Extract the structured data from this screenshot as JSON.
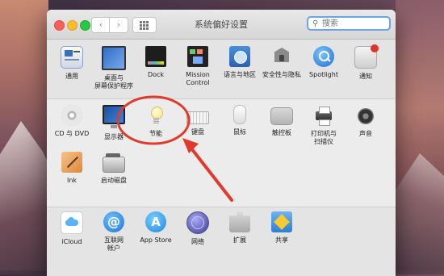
{
  "window": {
    "title": "系统偏好设置"
  },
  "toolbar": {
    "back": "‹",
    "forward": "›"
  },
  "search": {
    "placeholder": "搜索",
    "icon": "magnifier-icon"
  },
  "row1": [
    {
      "label": "通用",
      "icon": "general-icon"
    },
    {
      "label": "桌面与\n屏幕保护程序",
      "icon": "desktop-screensaver-icon"
    },
    {
      "label": "Dock",
      "icon": "dock-icon"
    },
    {
      "label": "Mission\nControl",
      "icon": "mission-control-icon"
    },
    {
      "label": "语言与地区",
      "icon": "language-region-icon"
    },
    {
      "label": "安全性与隐私",
      "icon": "security-privacy-icon"
    },
    {
      "label": "Spotlight",
      "icon": "spotlight-icon"
    },
    {
      "label": "通知",
      "icon": "notifications-icon"
    }
  ],
  "row2": [
    {
      "label": "CD 与 DVD",
      "icon": "cd-dvd-icon"
    },
    {
      "label": "显示器",
      "icon": "displays-icon"
    },
    {
      "label": "节能",
      "icon": "energy-saver-icon"
    },
    {
      "label": "键盘",
      "icon": "keyboard-icon"
    },
    {
      "label": "鼠标",
      "icon": "mouse-icon"
    },
    {
      "label": "触控板",
      "icon": "trackpad-icon"
    },
    {
      "label": "打印机与\n扫描仪",
      "icon": "printers-scanners-icon"
    },
    {
      "label": "声音",
      "icon": "sound-icon"
    }
  ],
  "row3": [
    {
      "label": "Ink",
      "icon": "ink-icon"
    },
    {
      "label": "启动磁盘",
      "icon": "startup-disk-icon"
    }
  ],
  "row4": [
    {
      "label": "iCloud",
      "icon": "icloud-icon"
    },
    {
      "label": "互联网\n帐户",
      "icon": "internet-accounts-icon"
    },
    {
      "label": "App Store",
      "icon": "app-store-icon"
    },
    {
      "label": "网络",
      "icon": "network-icon"
    },
    {
      "label": "扩展",
      "icon": "extensions-icon"
    },
    {
      "label": "共享",
      "icon": "sharing-icon"
    }
  ],
  "colors": {
    "annotation": "#e03a2e",
    "search_focus": "#6ca2e6"
  }
}
